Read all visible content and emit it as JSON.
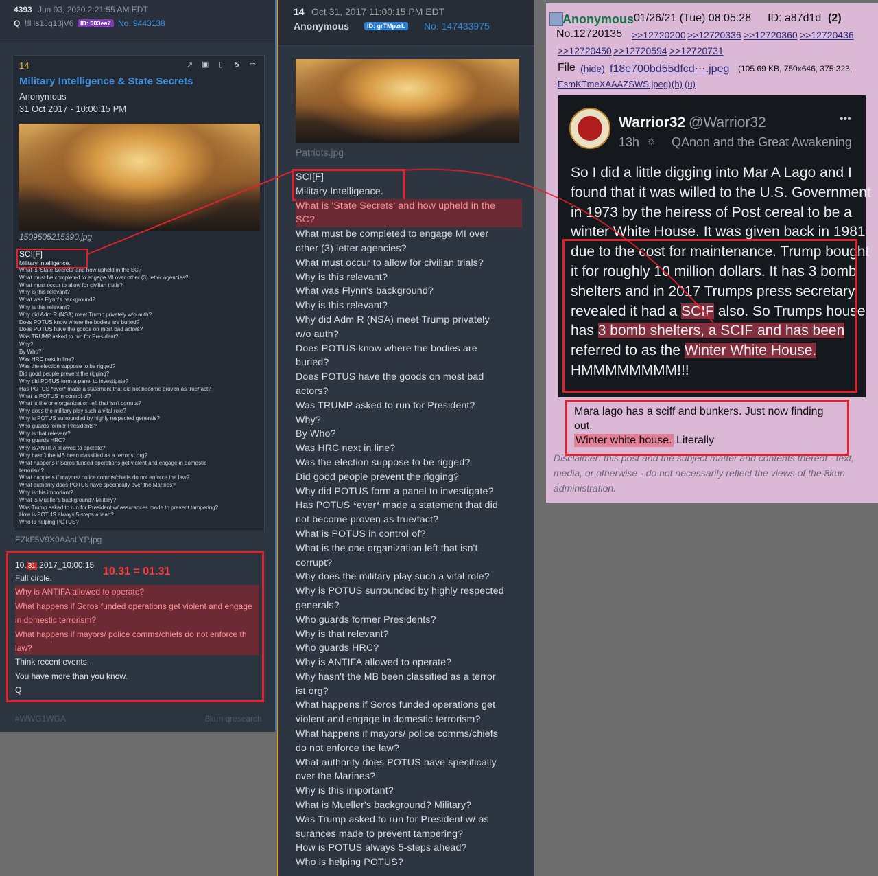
{
  "left": {
    "post_number": "4393",
    "timestamp": "Jun 03, 2020 2:21:55 AM EDT",
    "author": "Q",
    "tripcode": "!!Hs1Jq13jV6",
    "id_badge": "ID: 903ea7",
    "post_no": "No. 9443138",
    "card": {
      "number": "14",
      "title": "Military Intelligence & State Secrets",
      "author": "Anonymous",
      "date": "31 Oct 2017 - 10:00:15 PM",
      "image_caption": "1509505215390.jpg",
      "sci": "SCI[F]",
      "mi": "Military Intelligence.",
      "questions": [
        "What is 'State Secrets' and how upheld in the SC?",
        "What must be completed to engage MI over other (3) letter agencies?",
        "What must occur to allow for civilian trials?",
        "Why is this relevant?",
        "What was Flynn's background?",
        "Why is this relevant?",
        "Why did Adm R (NSA) meet Trump privately w/o auth?",
        "Does POTUS know where the bodies are buried?",
        "Does POTUS have the goods on most bad actors?",
        "Was TRUMP asked to run for President?",
        "Why?",
        "By Who?",
        "Was HRC next in line?",
        "Was the election suppose to be rigged?",
        "Did good people prevent the rigging?",
        "Why did POTUS form a panel to investigate?",
        "Has POTUS *ever* made a statement that did not become proven as true/fact?",
        "What is POTUS in control of?",
        "What is the one organization left that isn't corrupt?",
        "Why does the military play such a vital role?",
        "Why is POTUS surrounded by highly respected generals?",
        "Who guards former Presidents?",
        "Why is that relevant?",
        "Who guards HRC?",
        "Why is ANTIFA allowed to operate?",
        "Why hasn't the MB been classified as a terrorist org?",
        "What happens if Soros funded operations get violent and engage in domestic",
        "terrorism?",
        "What happens if mayors/ police comms/chiefs do not enforce the law?",
        "What authority does POTUS have specifically over the Marines?",
        "Why is this important?",
        "What is Mueller's background? Military?",
        "Was Trump asked to run for President w/ assurances made to prevent tampering?",
        "How is POTUS always 5-steps ahead?",
        "Who is helping POTUS?"
      ]
    },
    "bottom_image_caption": "EZkF5V9X0AAsLYP.jpg",
    "date_prefix": "10.",
    "date_hl": "31",
    "date_suffix": ".2017_10:00:15",
    "equation": "10.31 = 01.31",
    "body_lines": [
      {
        "text": "Full circle.",
        "hl": false
      },
      {
        "text": "Why is ANTIFA allowed to operate?",
        "hl": true
      },
      {
        "text": "What happens if Soros funded operations get violent and engage",
        "hl": true
      },
      {
        "text": "in domestic terrorism?",
        "hl": true
      },
      {
        "text": "What happens if mayors/ police comms/chiefs do not enforce th",
        "hl": true
      },
      {
        "text": "law?",
        "hl": true
      },
      {
        "text": "Think recent events.",
        "hl": false
      },
      {
        "text": "You have more than you know.",
        "hl": false
      },
      {
        "text": "Q",
        "hl": false
      }
    ],
    "footer_tag": "#WWG1WGA",
    "footer_source": "8kun qresearch"
  },
  "middle": {
    "number": "14",
    "timestamp": "Oct 31, 2017 11:00:15 PM EDT",
    "author": "Anonymous",
    "id_badge": "ID: grTMpzrL",
    "post_no": "No. 147433975",
    "image_caption": "Patriots.jpg",
    "lines": [
      {
        "text": "SCI[F]",
        "hl": false
      },
      {
        "text": "Military Intelligence.",
        "hl": false
      },
      {
        "text": "What is 'State Secrets' and how upheld in the",
        "hl": true
      },
      {
        "text": "SC?",
        "hl": true
      },
      {
        "text": "What must be completed to engage MI over",
        "hl": false
      },
      {
        "text": "other (3) letter agencies?",
        "hl": false
      },
      {
        "text": "What must occur to allow for civilian trials?",
        "hl": false
      },
      {
        "text": "Why is this relevant?",
        "hl": false
      },
      {
        "text": "What was Flynn's background?",
        "hl": false
      },
      {
        "text": "Why is this relevant?",
        "hl": false
      },
      {
        "text": "Why did Adm R (NSA) meet Trump privately",
        "hl": false
      },
      {
        "text": "w/o auth?",
        "hl": false
      },
      {
        "text": "Does POTUS know where the bodies are",
        "hl": false
      },
      {
        "text": "buried?",
        "hl": false
      },
      {
        "text": "Does POTUS have the goods on most bad",
        "hl": false
      },
      {
        "text": "actors?",
        "hl": false
      },
      {
        "text": "Was TRUMP asked to run for President?",
        "hl": false
      },
      {
        "text": "Why?",
        "hl": false
      },
      {
        "text": "By Who?",
        "hl": false
      },
      {
        "text": "Was HRC next in line?",
        "hl": false
      },
      {
        "text": "Was the election suppose to be rigged?",
        "hl": false
      },
      {
        "text": "Did good people prevent the rigging?",
        "hl": false
      },
      {
        "text": "Why did POTUS form a panel to investigate?",
        "hl": false
      },
      {
        "text": "Has POTUS *ever* made a statement that did",
        "hl": false
      },
      {
        "text": "not become proven as true/fact?",
        "hl": false
      },
      {
        "text": "What is POTUS in control of?",
        "hl": false
      },
      {
        "text": "What is the one organization left that isn't",
        "hl": false
      },
      {
        "text": "corrupt?",
        "hl": false
      },
      {
        "text": "Why does the military play such a vital role?",
        "hl": false
      },
      {
        "text": "Why is POTUS surrounded by highly respected",
        "hl": false
      },
      {
        "text": "generals?",
        "hl": false
      },
      {
        "text": "Who guards former Presidents?",
        "hl": false
      },
      {
        "text": "Why is that relevant?",
        "hl": false
      },
      {
        "text": "Who guards HRC?",
        "hl": false
      },
      {
        "text": "Why is ANTIFA allowed to operate?",
        "hl": false
      },
      {
        "text": "Why hasn't the MB been classified as a terror",
        "hl": false
      },
      {
        "text": "ist org?",
        "hl": false
      },
      {
        "text": "What happens if Soros funded operations get",
        "hl": false
      },
      {
        "text": "violent and engage in domestic terrorism?",
        "hl": false
      },
      {
        "text": "What happens if mayors/ police comms/chiefs",
        "hl": false
      },
      {
        "text": "do not enforce the law?",
        "hl": false
      },
      {
        "text": "What authority does POTUS have specifically",
        "hl": false
      },
      {
        "text": "over the Marines?",
        "hl": false
      },
      {
        "text": "Why is this important?",
        "hl": false
      },
      {
        "text": "What is Mueller's background? Military?",
        "hl": false
      },
      {
        "text": "Was Trump asked to run for President w/ as",
        "hl": false
      },
      {
        "text": "surances made to prevent tampering?",
        "hl": false
      },
      {
        "text": "How is POTUS always 5-steps ahead?",
        "hl": false
      },
      {
        "text": "Who is helping POTUS?",
        "hl": false
      }
    ]
  },
  "right": {
    "author": "Anonymous",
    "datetime": "01/26/21 (Tue) 08:05:28",
    "id_label": "ID: a87d1d",
    "id_count": "(2)",
    "post_no": "No.12720135",
    "replies": [
      ">>12720200",
      ">>12720336",
      ">>12720360",
      ">>12720436",
      ">>12720450",
      ">>12720594",
      ">>12720731"
    ],
    "file_label": "File",
    "file_hide": "(hide)",
    "file_name": "f18e700bd55dfcd⋯.jpeg",
    "file_meta": "(105.69 KB, 750x646, 375:323,",
    "file_name2": "EsmKTmeXAAAZSWS.jpeg)",
    "file_h": "(h)",
    "file_u": "(u)",
    "tweet": {
      "name": "Warrior32",
      "handle": "@Warrior32",
      "age": "13h",
      "community": "QAnon and the Great Awakening",
      "more": "•••",
      "lines": [
        "So I did a little digging into Mar A Lago and I",
        "found that it was willed to the U.S. Government",
        "in 1973 by the heiress of Post cereal to be a",
        "winter White House. It was given back in 1981",
        "due to the cost for maintenance. Trump bought",
        "it for roughly 10 million dollars. It has 3 bomb",
        "shelters and in 2017 Trumps press secretary"
      ],
      "l8_pre": "revealed it had a ",
      "l8_hl": "SCIF",
      "l8_post": " also. So Trumps house",
      "l9_pre": "has ",
      "l9_hl": "3 bomb shelters, a SCIF and has been",
      "l10_pre": "referred to as the ",
      "l10_hl": "Winter White House.",
      "l11": "HMMMMMMMM!!!"
    },
    "reply_line1": "Mara lago has a sciff and bunkers.  Just now finding",
    "reply_line2": "out.",
    "reply_hl": "Winter white house.",
    "reply_tail": " Literally",
    "disclaimer": [
      "Disclaimer: this post and the subject matter and contents thereof - text,",
      "media, or otherwise - do not necessarily reflect the views of the 8kun",
      "administration."
    ]
  },
  "colors": {
    "highlight_red": "#e1212c",
    "left_bg": "#2c3440",
    "right_bg": "#dbb8d6",
    "link_blue": "#3d8fe0"
  }
}
